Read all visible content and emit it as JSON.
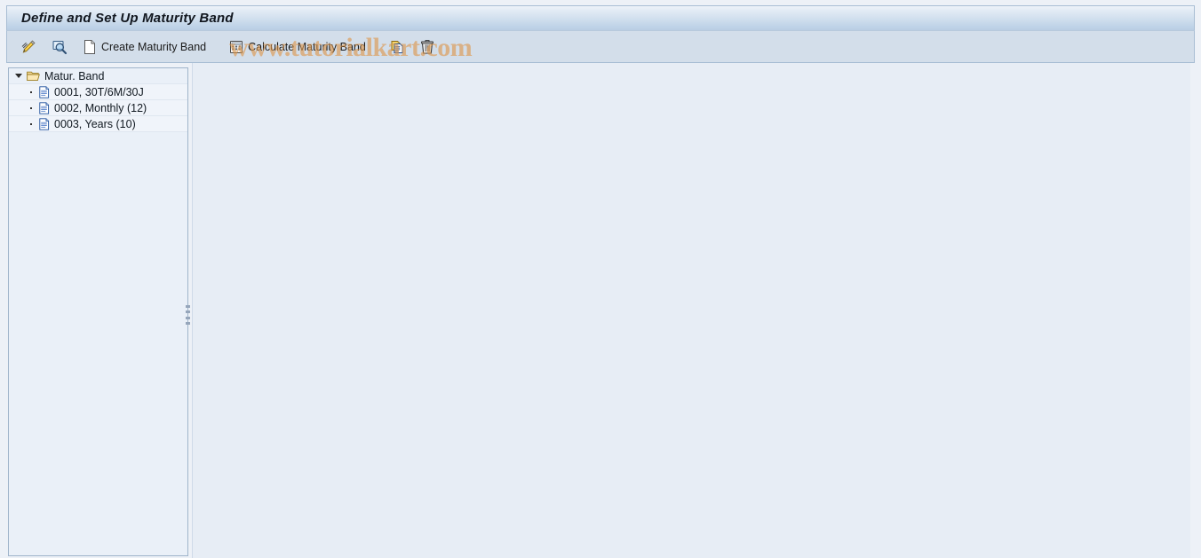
{
  "window": {
    "title": "Define and Set Up Maturity Band"
  },
  "watermark": {
    "text": "www.tutorialkart.com",
    "color": "#dd964b"
  },
  "toolbar": {
    "buttons": [
      {
        "name": "change-button",
        "icon": "pencil-icon",
        "label": ""
      },
      {
        "name": "display-button",
        "icon": "magnifier-display-icon",
        "label": ""
      },
      {
        "name": "create-maturity-band-button",
        "icon": "new-document-icon",
        "label": "Create Maturity Band"
      },
      {
        "name": "calculate-maturity-band-button",
        "icon": "calculator-icon",
        "label": "Calculate Maturity Band"
      },
      {
        "name": "copy-button",
        "icon": "copy-icon",
        "label": ""
      },
      {
        "name": "delete-button",
        "icon": "trash-icon",
        "label": ""
      }
    ]
  },
  "tree": {
    "root": {
      "label": "Matur. Band",
      "icon": "open-folder-icon",
      "expanded": true
    },
    "items": [
      {
        "label": "0001, 30T/6M/30J",
        "icon": "document-icon"
      },
      {
        "label": "0002, Monthly (12)",
        "icon": "document-icon"
      },
      {
        "label": "0003, Years (10)",
        "icon": "document-icon"
      }
    ]
  },
  "colors": {
    "titlebar_accent": "#bed2e7",
    "toolbar_bg": "#d3deea",
    "content_bg": "#e7edf5",
    "tree_bg": "#eaf0f8"
  }
}
